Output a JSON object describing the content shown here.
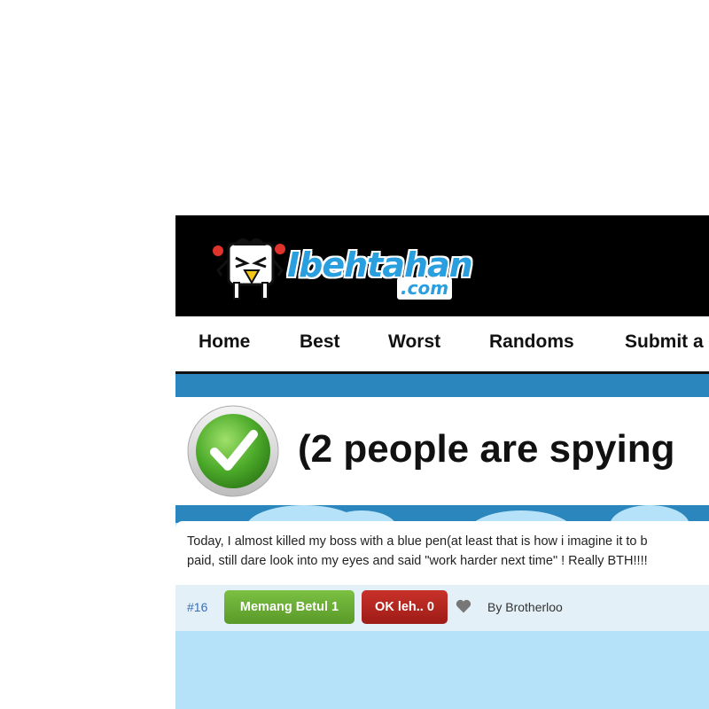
{
  "site": {
    "logo_text": "Ibehtahan",
    "logo_domain": ".com"
  },
  "nav": {
    "items": [
      "Home",
      "Best",
      "Worst",
      "Randoms",
      "Submit a"
    ]
  },
  "banner": {
    "text": "(2 people are spying"
  },
  "post": {
    "line1": "Today, I almost killed my boss with a blue pen(at least that is how i imagine it to b",
    "line2": "paid, still dare look into my eyes and said \"work harder next time\" ! Really BTH!!!!",
    "number": "#16",
    "agree_label": "Memang Betul 1",
    "disagree_label": "OK leh.. 0",
    "author": "By Brotherloo"
  },
  "colors": {
    "header_bg": "#000000",
    "accent_blue": "#2b86bd",
    "page_bg": "#b5e2f8",
    "agree_green": "#6aad34",
    "disagree_red": "#b32620"
  },
  "icons": {
    "logo_mascot": "penguin-mascot-icon",
    "check": "green-check-icon",
    "heart": "heart-icon"
  }
}
